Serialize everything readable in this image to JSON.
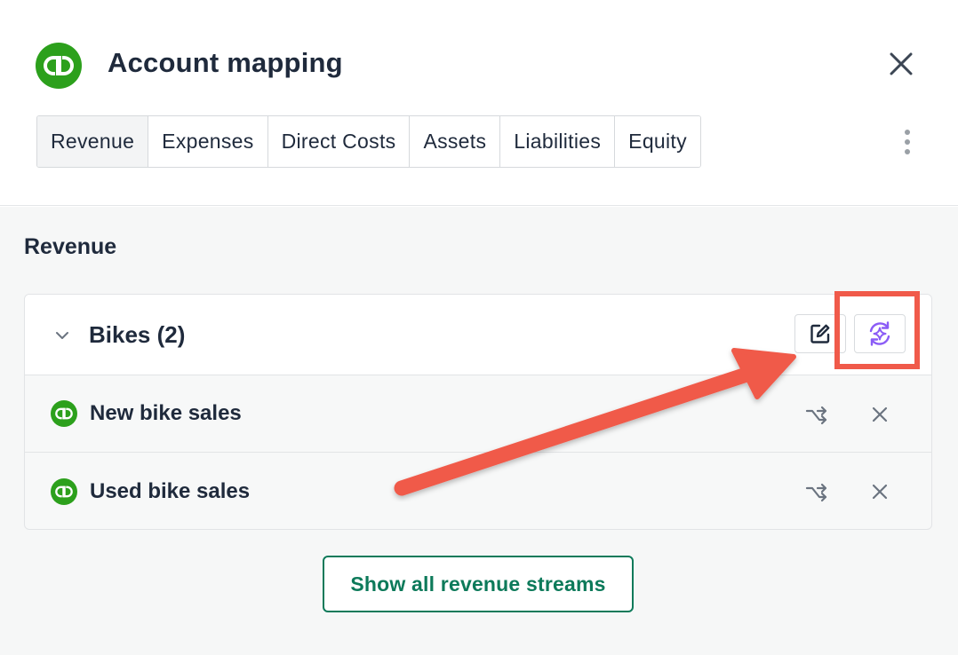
{
  "header": {
    "title": "Account mapping",
    "logo_icon": "quickbooks-logo-icon",
    "close_icon": "close-icon",
    "more_icon": "kebab-menu-icon"
  },
  "tabs": [
    {
      "label": "Revenue",
      "active": true
    },
    {
      "label": "Expenses",
      "active": false
    },
    {
      "label": "Direct Costs",
      "active": false
    },
    {
      "label": "Assets",
      "active": false
    },
    {
      "label": "Liabilities",
      "active": false
    },
    {
      "label": "Equity",
      "active": false
    }
  ],
  "section": {
    "title": "Revenue",
    "group": {
      "title": "Bikes (2)",
      "edit_icon": "edit-icon",
      "ai_remap_icon": "ai-refresh-icon",
      "items": [
        {
          "label": "New bike sales",
          "remap_icon": "remap-icon",
          "remove_icon": "close-icon"
        },
        {
          "label": "Used bike sales",
          "remap_icon": "remap-icon",
          "remove_icon": "close-icon"
        }
      ]
    }
  },
  "footer": {
    "show_all_label": "Show all revenue streams"
  },
  "colors": {
    "qb_green": "#2ca01c",
    "accent_green": "#0d7a5a",
    "ai_purple": "#8b5cf6",
    "annotation_red": "#f05a4a"
  }
}
